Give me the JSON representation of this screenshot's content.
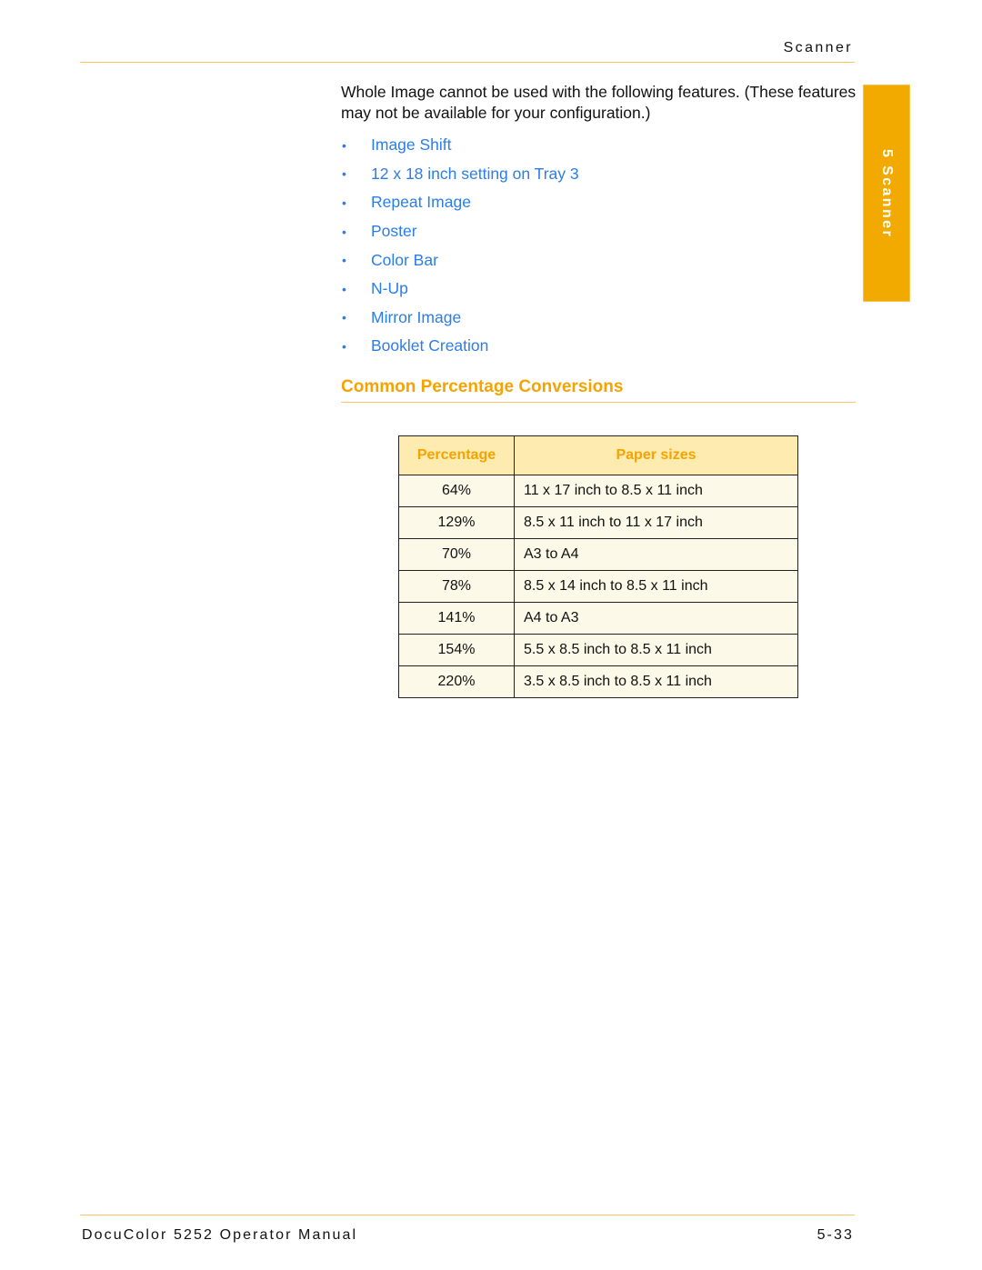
{
  "header": {
    "running_title": "Scanner"
  },
  "side_tab": {
    "label": "5 Scanner",
    "color": "#f2a900"
  },
  "intro": {
    "text": "Whole Image cannot be used with the following features. (These features may not be available for your configuration.)"
  },
  "features": {
    "bullet_glyph": "•",
    "items": [
      "Image Shift",
      "12 x 18 inch setting on Tray 3",
      "Repeat Image",
      "Poster",
      "Color Bar",
      "N-Up",
      "Mirror Image",
      "Booklet Creation"
    ]
  },
  "section": {
    "title": "Common Percentage Conversions"
  },
  "table": {
    "headers": [
      "Percentage",
      "Paper sizes"
    ],
    "rows": [
      [
        "64%",
        "11 x 17 inch to 8.5 x 11 inch"
      ],
      [
        "129%",
        "8.5 x 11 inch to 11 x 17 inch"
      ],
      [
        "70%",
        "A3 to A4"
      ],
      [
        "78%",
        "8.5 x 14 inch to 8.5 x 11 inch"
      ],
      [
        "141%",
        "A4 to A3"
      ],
      [
        "154%",
        "5.5 x 8.5 inch to 8.5 x 11 inch"
      ],
      [
        "220%",
        "3.5 x 8.5 inch to 8.5 x 11 inch"
      ]
    ]
  },
  "footer": {
    "manual_title": "DocuColor 5252 Operator Manual",
    "page_number": "5-33"
  },
  "colors": {
    "accent_orange": "#f5a300",
    "link_blue": "#2b7de9",
    "rule": "#f9c46a",
    "table_header_bg": "#fdebb0",
    "table_cell_bg": "#fdf9e8"
  }
}
